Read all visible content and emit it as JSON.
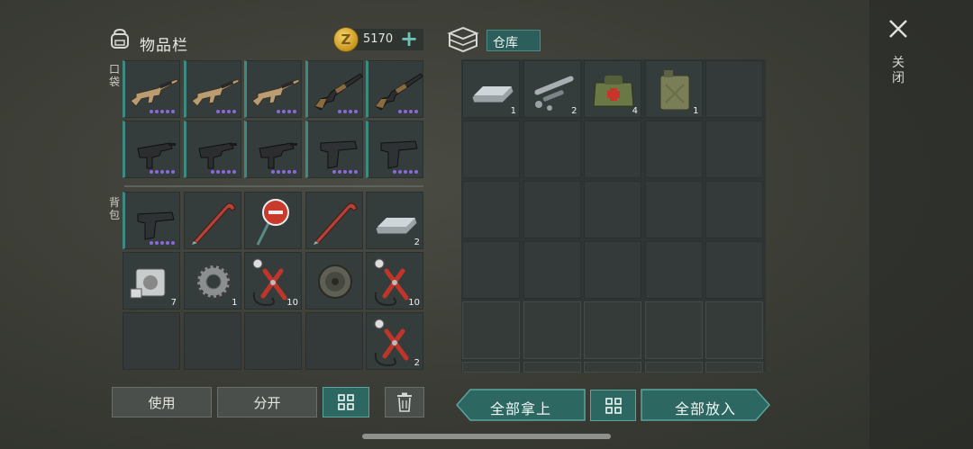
{
  "inventory": {
    "title": "物品栏",
    "coins": "5170",
    "coin_symbol": "Z",
    "add_symbol": "+",
    "pocket_label": "口袋",
    "backpack_label": "背包",
    "pocket_items": [
      {
        "icon": "assault-rifle-icon",
        "qty": "",
        "rarity_dots": 5
      },
      {
        "icon": "assault-rifle-icon",
        "qty": "",
        "rarity_dots": 4
      },
      {
        "icon": "assault-rifle-icon",
        "qty": "",
        "rarity_dots": 4
      },
      {
        "icon": "shotgun-icon",
        "qty": "",
        "rarity_dots": 4
      },
      {
        "icon": "shotgun-icon",
        "qty": "",
        "rarity_dots": 4
      },
      {
        "icon": "submachine-gun-icon",
        "qty": "",
        "rarity_dots": 5
      },
      {
        "icon": "submachine-gun-icon",
        "qty": "",
        "rarity_dots": 5
      },
      {
        "icon": "submachine-gun-icon",
        "qty": "",
        "rarity_dots": 5
      },
      {
        "icon": "pistol-icon",
        "qty": "",
        "rarity_dots": 5
      },
      {
        "icon": "pistol-icon",
        "qty": "",
        "rarity_dots": 5
      }
    ],
    "backpack_items": [
      {
        "icon": "pistol-icon",
        "qty": "",
        "rarity_dots": 5
      },
      {
        "icon": "crowbar-icon",
        "qty": "",
        "rarity_dots": 0
      },
      {
        "icon": "stop-sign-icon",
        "qty": "",
        "rarity_dots": 0
      },
      {
        "icon": "crowbar-icon",
        "qty": "",
        "rarity_dots": 0
      },
      {
        "icon": "metal-ingot-icon",
        "qty": "2",
        "rarity_dots": 0
      },
      {
        "icon": "engine-cylinder-icon",
        "qty": "7",
        "rarity_dots": 0
      },
      {
        "icon": "gear-icon",
        "qty": "1",
        "rarity_dots": 0
      },
      {
        "icon": "pliers-wire-icon",
        "qty": "10",
        "rarity_dots": 0
      },
      {
        "icon": "wire-spool-icon",
        "qty": "",
        "rarity_dots": 0
      },
      {
        "icon": "pliers-wire-icon",
        "qty": "10",
        "rarity_dots": 0
      },
      {
        "icon": "",
        "qty": "",
        "rarity_dots": 0
      },
      {
        "icon": "",
        "qty": "",
        "rarity_dots": 0
      },
      {
        "icon": "",
        "qty": "",
        "rarity_dots": 0
      },
      {
        "icon": "",
        "qty": "",
        "rarity_dots": 0
      },
      {
        "icon": "pliers-wire-icon",
        "qty": "2",
        "rarity_dots": 0
      }
    ],
    "use_label": "使用",
    "split_label": "分开"
  },
  "warehouse": {
    "title": "仓库",
    "items": [
      {
        "icon": "metal-ingot-icon",
        "qty": "1"
      },
      {
        "icon": "pipe-parts-icon",
        "qty": "2"
      },
      {
        "icon": "medical-bag-icon",
        "qty": "4"
      },
      {
        "icon": "jerrycan-icon",
        "qty": "1"
      }
    ],
    "take_all_label": "全部拿上",
    "put_all_label": "全部放入"
  },
  "close_label": "关闭",
  "colors": {
    "accent_teal": "#2d6761",
    "rarity_purple": "#8b6ad8",
    "coin_gold": "#d9a72a"
  }
}
